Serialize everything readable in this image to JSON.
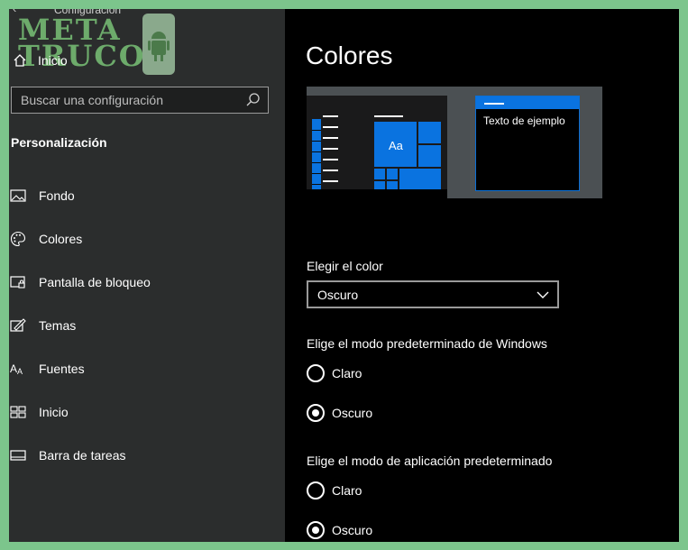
{
  "window": {
    "title": "Configuración",
    "back_glyph": "‹"
  },
  "watermark": {
    "line1": "META",
    "line2": "TRUCO"
  },
  "sidebar": {
    "home_label": "Inicio",
    "search_placeholder": "Buscar una configuración",
    "section_title": "Personalización",
    "items": [
      {
        "label": "Fondo",
        "icon": "picture-icon"
      },
      {
        "label": "Colores",
        "icon": "palette-icon"
      },
      {
        "label": "Pantalla de bloqueo",
        "icon": "lock-screen-icon"
      },
      {
        "label": "Temas",
        "icon": "themes-icon"
      },
      {
        "label": "Fuentes",
        "icon": "fonts-icon"
      },
      {
        "label": "Inicio",
        "icon": "start-icon"
      },
      {
        "label": "Barra de tareas",
        "icon": "taskbar-icon"
      }
    ]
  },
  "main": {
    "title": "Colores",
    "preview": {
      "sample_text": "Texto de ejemplo",
      "tile_label": "Aa"
    },
    "choose_color": {
      "label": "Elegir el color",
      "value": "Oscuro"
    },
    "windows_mode": {
      "label": "Elige el modo predeterminado de Windows",
      "options": [
        "Claro",
        "Oscuro"
      ],
      "selected": "Oscuro"
    },
    "app_mode": {
      "label": "Elige el modo de aplicación predeterminado",
      "options": [
        "Claro",
        "Oscuro"
      ],
      "selected": "Oscuro"
    }
  },
  "colors": {
    "accent": "#0a73e0",
    "sidebar_bg": "#2b2d2d",
    "main_bg": "#000000"
  }
}
